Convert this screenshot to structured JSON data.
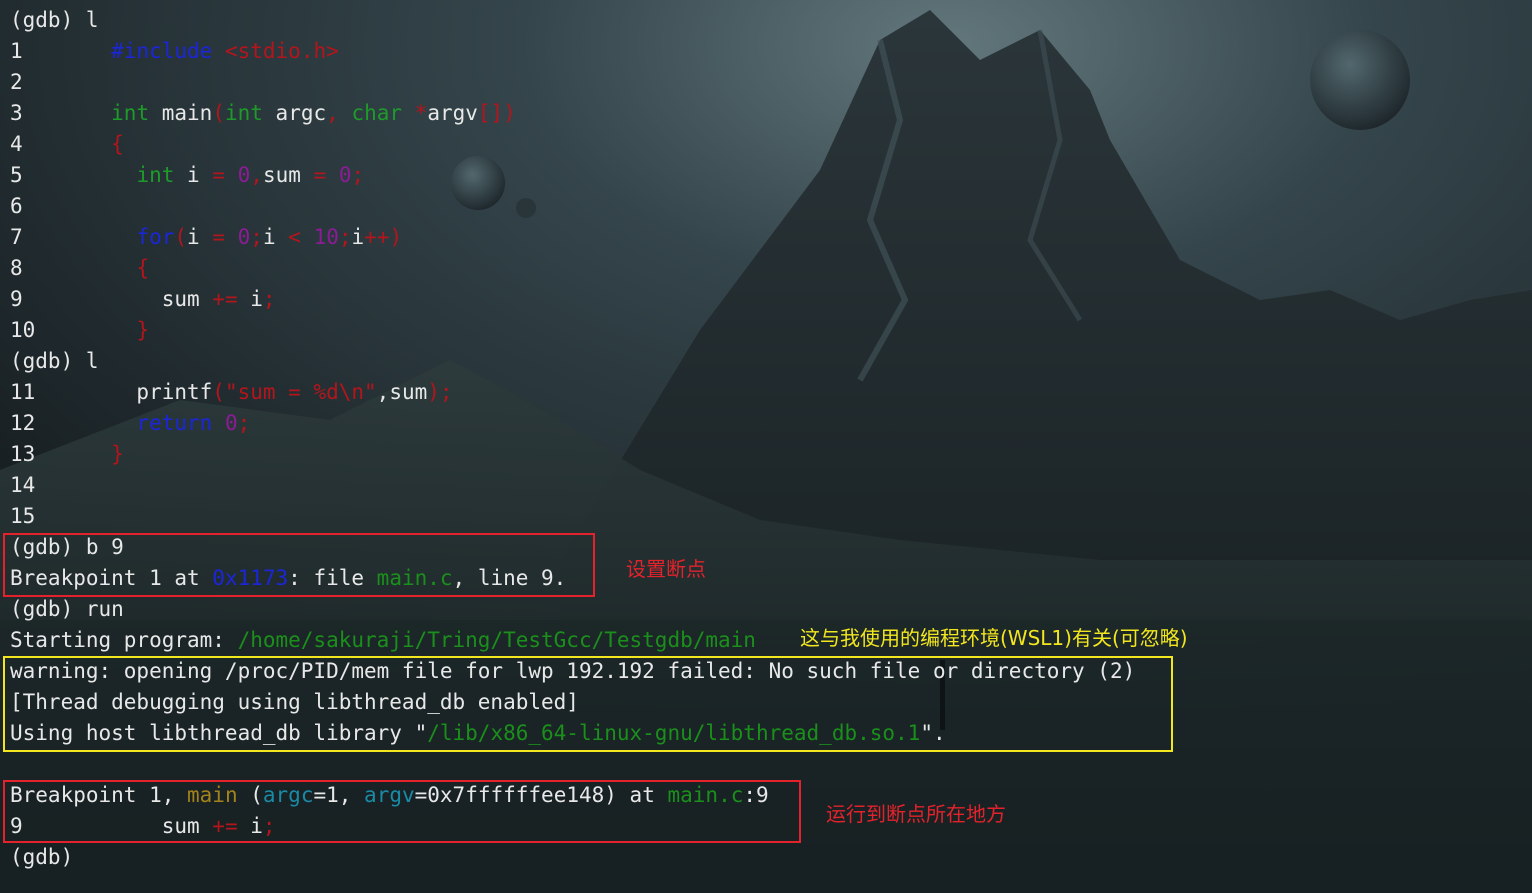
{
  "terminal": {
    "lines": [
      {
        "row": 0,
        "segments": [
          {
            "t": "(gdb) l"
          }
        ]
      },
      {
        "row": 1,
        "segments": [
          {
            "t": "1       "
          },
          {
            "t": "#include",
            "c": "c-blue"
          },
          {
            "t": " "
          },
          {
            "t": "<stdio.h>",
            "c": "c-red"
          }
        ]
      },
      {
        "row": 2,
        "segments": [
          {
            "t": "2"
          }
        ]
      },
      {
        "row": 3,
        "segments": [
          {
            "t": "3       "
          },
          {
            "t": "int",
            "c": "c-kw"
          },
          {
            "t": " main"
          },
          {
            "t": "(",
            "c": "c-red"
          },
          {
            "t": "int",
            "c": "c-kw"
          },
          {
            "t": " argc"
          },
          {
            "t": ",",
            "c": "c-red"
          },
          {
            "t": " "
          },
          {
            "t": "char",
            "c": "c-kw"
          },
          {
            "t": " "
          },
          {
            "t": "*",
            "c": "c-red"
          },
          {
            "t": "argv"
          },
          {
            "t": "[])",
            "c": "c-red"
          }
        ]
      },
      {
        "row": 4,
        "segments": [
          {
            "t": "4       "
          },
          {
            "t": "{",
            "c": "c-red"
          }
        ]
      },
      {
        "row": 5,
        "segments": [
          {
            "t": "5         "
          },
          {
            "t": "int",
            "c": "c-kw"
          },
          {
            "t": " i "
          },
          {
            "t": "=",
            "c": "c-red"
          },
          {
            "t": " "
          },
          {
            "t": "0",
            "c": "c-mag"
          },
          {
            "t": ",",
            "c": "c-red"
          },
          {
            "t": "sum "
          },
          {
            "t": "=",
            "c": "c-red"
          },
          {
            "t": " "
          },
          {
            "t": "0",
            "c": "c-mag"
          },
          {
            "t": ";",
            "c": "c-red"
          }
        ]
      },
      {
        "row": 6,
        "segments": [
          {
            "t": "6"
          }
        ]
      },
      {
        "row": 7,
        "segments": [
          {
            "t": "7         "
          },
          {
            "t": "for",
            "c": "c-blue"
          },
          {
            "t": "(",
            "c": "c-red"
          },
          {
            "t": "i "
          },
          {
            "t": "=",
            "c": "c-red"
          },
          {
            "t": " "
          },
          {
            "t": "0",
            "c": "c-mag"
          },
          {
            "t": ";",
            "c": "c-red"
          },
          {
            "t": "i "
          },
          {
            "t": "<",
            "c": "c-red"
          },
          {
            "t": " "
          },
          {
            "t": "10",
            "c": "c-mag"
          },
          {
            "t": ";",
            "c": "c-red"
          },
          {
            "t": "i"
          },
          {
            "t": "++)",
            "c": "c-red"
          }
        ]
      },
      {
        "row": 8,
        "segments": [
          {
            "t": "8         "
          },
          {
            "t": "{",
            "c": "c-red"
          }
        ]
      },
      {
        "row": 9,
        "segments": [
          {
            "t": "9           sum "
          },
          {
            "t": "+=",
            "c": "c-red"
          },
          {
            "t": " i"
          },
          {
            "t": ";",
            "c": "c-red"
          }
        ]
      },
      {
        "row": 10,
        "segments": [
          {
            "t": "10        "
          },
          {
            "t": "}",
            "c": "c-red"
          }
        ]
      },
      {
        "row": 11,
        "segments": [
          {
            "t": "(gdb) l"
          }
        ]
      },
      {
        "row": 12,
        "segments": [
          {
            "t": "11        printf"
          },
          {
            "t": "(\"sum = %d\\n\"",
            "c": "c-red"
          },
          {
            "t": ",sum"
          },
          {
            "t": ");",
            "c": "c-red"
          }
        ]
      },
      {
        "row": 13,
        "segments": [
          {
            "t": "12        "
          },
          {
            "t": "return",
            "c": "c-blue"
          },
          {
            "t": " "
          },
          {
            "t": "0",
            "c": "c-mag"
          },
          {
            "t": ";",
            "c": "c-red"
          }
        ]
      },
      {
        "row": 14,
        "segments": [
          {
            "t": "13      "
          },
          {
            "t": "}",
            "c": "c-red"
          }
        ]
      },
      {
        "row": 15,
        "segments": [
          {
            "t": "14"
          }
        ]
      },
      {
        "row": 16,
        "segments": [
          {
            "t": "15"
          }
        ]
      },
      {
        "row": 17,
        "segments": [
          {
            "t": "(gdb) b 9"
          }
        ]
      },
      {
        "row": 18,
        "segments": [
          {
            "t": "Breakpoint 1 at "
          },
          {
            "t": "0x1173",
            "c": "c-blue"
          },
          {
            "t": ": file "
          },
          {
            "t": "main.c",
            "c": "c-green"
          },
          {
            "t": ", line 9."
          }
        ]
      },
      {
        "row": 19,
        "segments": [
          {
            "t": "(gdb) run"
          }
        ]
      },
      {
        "row": 20,
        "segments": [
          {
            "t": "Starting program: "
          },
          {
            "t": "/home/sakuraji/Tring/TestGcc/Testgdb/main",
            "c": "c-green"
          }
        ]
      },
      {
        "row": 21,
        "segments": [
          {
            "t": "warning: opening /proc/PID/mem file for lwp 192.192 failed: No such file or directory (2)"
          }
        ]
      },
      {
        "row": 22,
        "segments": [
          {
            "t": "[Thread debugging using libthread_db enabled]"
          }
        ]
      },
      {
        "row": 23,
        "segments": [
          {
            "t": "Using host libthread_db library \""
          },
          {
            "t": "/lib/x86_64-linux-gnu/libthread_db.so.1",
            "c": "c-green"
          },
          {
            "t": "\"."
          }
        ]
      },
      {
        "row": 24,
        "segments": [
          {
            "t": ""
          }
        ]
      },
      {
        "row": 25,
        "segments": [
          {
            "t": "Breakpoint 1, "
          },
          {
            "t": "main",
            "c": "c-gold"
          },
          {
            "t": " ("
          },
          {
            "t": "argc",
            "c": "c-cyan"
          },
          {
            "t": "=1, "
          },
          {
            "t": "argv",
            "c": "c-cyan"
          },
          {
            "t": "=0x7ffffffee148) at "
          },
          {
            "t": "main.c",
            "c": "c-green"
          },
          {
            "t": ":9"
          }
        ]
      },
      {
        "row": 26,
        "segments": [
          {
            "t": "9           sum "
          },
          {
            "t": "+=",
            "c": "c-red"
          },
          {
            "t": " i"
          },
          {
            "t": ";",
            "c": "c-red"
          }
        ]
      },
      {
        "row": 27,
        "segments": [
          {
            "t": "(gdb)"
          }
        ]
      }
    ]
  },
  "annotations": {
    "set_breakpoint": "设置断点",
    "wsl_note": "这与我使用的编程环境(WSL1)有关(可忽略)",
    "run_to_breakpoint": "运行到断点所在地方"
  },
  "colors": {
    "red_box": "#e3222c",
    "yellow_box": "#f2e61e",
    "red_text": "#e3222c",
    "yellow_text": "#f2e61e"
  }
}
